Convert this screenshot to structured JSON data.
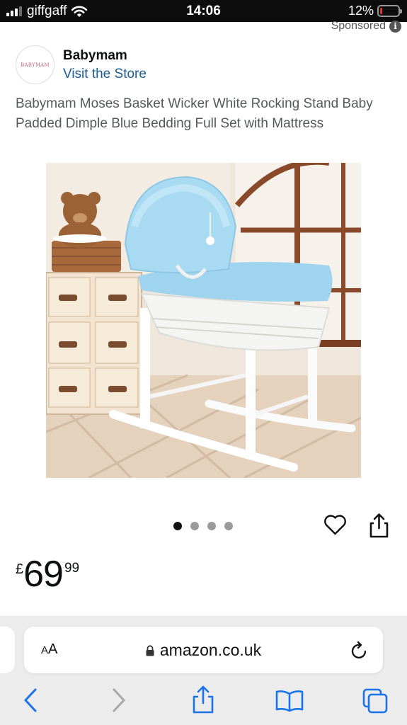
{
  "status_bar": {
    "carrier": "giffgaff",
    "time": "14:06",
    "battery_percent": "12%",
    "battery_level": 0.12,
    "battery_color": "#e8352c",
    "icons": [
      "signal-icon",
      "wifi-icon",
      "battery-icon"
    ]
  },
  "ad": {
    "sponsored_label": "Sponsored",
    "info_icon": "i"
  },
  "brand": {
    "logo_text": "BABYMAM",
    "name": "Babymam",
    "visit_store": "Visit the Store",
    "link_color": "#1a5b93"
  },
  "product": {
    "title": "Babymam Moses Basket Wicker White Rocking Stand Baby Padded Dimple Blue Bedding Full Set with Mattress",
    "image_count": 4,
    "active_image": 0,
    "price": {
      "symbol": "£",
      "whole": "69",
      "fraction": "99"
    },
    "actions": [
      "heart-icon",
      "share-icon"
    ]
  },
  "browser": {
    "aa_label_small": "A",
    "aa_label_large": "A",
    "url": "amazon.co.uk",
    "toolbar": [
      "back-icon",
      "forward-icon",
      "share-icon",
      "bookmarks-icon",
      "tabs-icon"
    ],
    "accent": "#1a73e8"
  }
}
